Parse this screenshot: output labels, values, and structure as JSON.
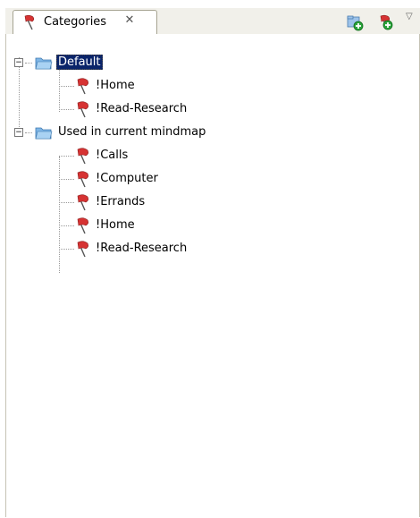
{
  "view": {
    "tab_title": "Categories",
    "tab_close_glyph": "✕",
    "menu_glyph": "▽",
    "toolbar_icons": [
      "add-folder-icon",
      "add-category-icon"
    ]
  },
  "tree": {
    "groups": [
      {
        "label": "Default",
        "selected": true,
        "items": [
          "!Home",
          "!Read-Research"
        ]
      },
      {
        "label": "Used in current mindmap",
        "selected": false,
        "items": [
          "!Calls",
          "!Computer",
          "!Errands",
          "!Home",
          "!Read-Research"
        ]
      }
    ]
  },
  "colors": {
    "flag_red": "#d63333",
    "folder_blue": "#7fb6e6",
    "selection": "#0a246a"
  }
}
